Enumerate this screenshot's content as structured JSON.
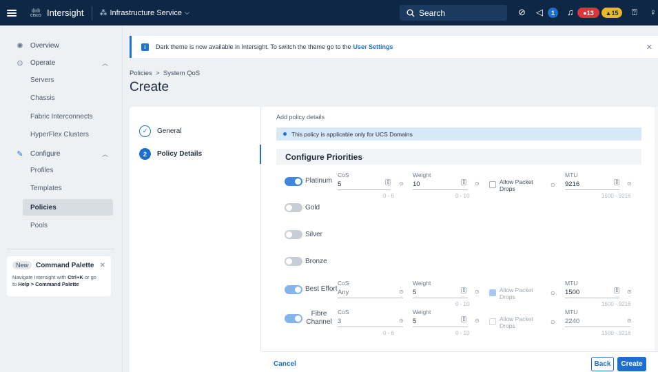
{
  "topbar": {
    "logo_text": "cisco",
    "app_name": "Intersight",
    "service_name": "Infrastructure Service",
    "search_label": "Search",
    "announcement_count": "1",
    "critical_count": "13",
    "warning_count": "15"
  },
  "sidebar": {
    "overview": "Overview",
    "operate": "Operate",
    "operate_items": [
      "Servers",
      "Chassis",
      "Fabric Interconnects",
      "HyperFlex Clusters"
    ],
    "configure": "Configure",
    "configure_items": [
      "Profiles",
      "Templates",
      "Policies",
      "Pools"
    ],
    "command_palette": {
      "badge": "New",
      "title": "Command Palette",
      "line1": "Navigate Intersight with",
      "shortcut": "Ctrl+K",
      "line1_end": "or go",
      "line2_pre": "to",
      "line2_path": "Help > Command Palette"
    }
  },
  "banner": {
    "text": "Dark theme is now available in Intersight. To switch the theme go to the",
    "link": "User Settings"
  },
  "breadcrumb": {
    "root": "Policies",
    "current": "System QoS"
  },
  "page_title": "Create",
  "steps": [
    {
      "number": "1",
      "label": "General"
    },
    {
      "number": "2",
      "label": "Policy Details"
    }
  ],
  "details": {
    "subtitle": "Add policy details",
    "note": "This policy is applicable only for UCS Domains",
    "section_title": "Configure Priorities"
  },
  "labels": {
    "cos": "CoS",
    "weight": "Weight",
    "mtu": "MTU",
    "allow_drops": "Allow Packet Drops"
  },
  "priorities": [
    {
      "name": "Platinum",
      "enabled": true,
      "cos": "5",
      "cos_range": "0 - 6",
      "weight": "10",
      "weight_range": "0 - 10",
      "mtu": "9216",
      "mtu_range": "1500 - 9216"
    },
    {
      "name": "Gold",
      "enabled": false
    },
    {
      "name": "Silver",
      "enabled": false
    },
    {
      "name": "Bronze",
      "enabled": false
    },
    {
      "name": "Best Effort",
      "enabled": true,
      "cos": "Any",
      "weight": "5",
      "weight_range": "0 - 10",
      "mtu": "1500",
      "mtu_range": "1500 - 9216"
    },
    {
      "name_line1": "Fibre",
      "name_line2": "Channel",
      "enabled": true,
      "cos": "3",
      "cos_range": "0 - 6",
      "weight": "5",
      "weight_range": "0 - 10",
      "mtu": "2240",
      "mtu_range": "1500 - 9216"
    }
  ],
  "footer": {
    "cancel": "Cancel",
    "back": "Back",
    "create": "Create"
  }
}
